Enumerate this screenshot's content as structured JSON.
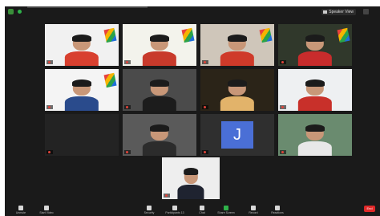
{
  "app": {
    "speaker_view_label": "Speaker View",
    "end_label": "End"
  },
  "toolbar": {
    "unmute": "Unmute",
    "start_video": "Start Video",
    "security": "Security",
    "participants": "Participants",
    "participants_count": "13",
    "chat": "Chat",
    "share_screen": "Share Screen",
    "record": "Record",
    "reactions": "Reactions"
  },
  "participants": [
    {
      "name": "",
      "kind": "video",
      "bg": "#f1f1f1",
      "shirt": "#d8402f"
    },
    {
      "name": "",
      "kind": "video",
      "bg": "#f3f3ec",
      "shirt": "#c83a2b",
      "speaking": true
    },
    {
      "name": "",
      "kind": "video",
      "bg": "#cfc6ba",
      "shirt": "#cf3a2a"
    },
    {
      "name": "",
      "kind": "video",
      "bg": "#30382b",
      "shirt": "#c82c2c"
    },
    {
      "name": "",
      "kind": "video",
      "bg": "#f4f4f4",
      "shirt": "#2a4b8c"
    },
    {
      "name": "",
      "kind": "video",
      "bg": "#4b4b4b",
      "shirt": "#1c1c1c"
    },
    {
      "name": "",
      "kind": "video",
      "bg": "#2b2418",
      "shirt": "#e2b36a"
    },
    {
      "name": "",
      "kind": "video",
      "bg": "#eef0f2",
      "shirt": "#c8302a"
    },
    {
      "name": "",
      "kind": "empty"
    },
    {
      "name": "",
      "kind": "video",
      "bg": "#5a5a5a",
      "shirt": "#2c2c2c"
    },
    {
      "name": "",
      "kind": "avatar",
      "initial": "J"
    },
    {
      "name": "",
      "kind": "video",
      "bg": "#6a8b6f",
      "shirt": "#e8e8e8"
    },
    {
      "name": "",
      "kind": "video",
      "bg": "#eeeeee",
      "shirt": "#1f2330"
    }
  ],
  "colors": {
    "app_bg": "#1a1a1a",
    "tile_bg": "#232323",
    "avatar_bg": "#4a6fd6",
    "active_speaker": "#d9e64a",
    "end_button": "#e02828",
    "muted": "#e0443a"
  },
  "icons": {
    "security_shield": "shield-icon",
    "speaker_view": "speaker-view-icon",
    "fullscreen": "fullscreen-icon",
    "mic": "mic-off-icon",
    "video": "video-off-icon",
    "security": "security-icon",
    "participants": "participants-icon",
    "chat": "chat-icon",
    "share": "share-screen-icon",
    "record": "record-icon",
    "reactions": "reactions-icon"
  }
}
